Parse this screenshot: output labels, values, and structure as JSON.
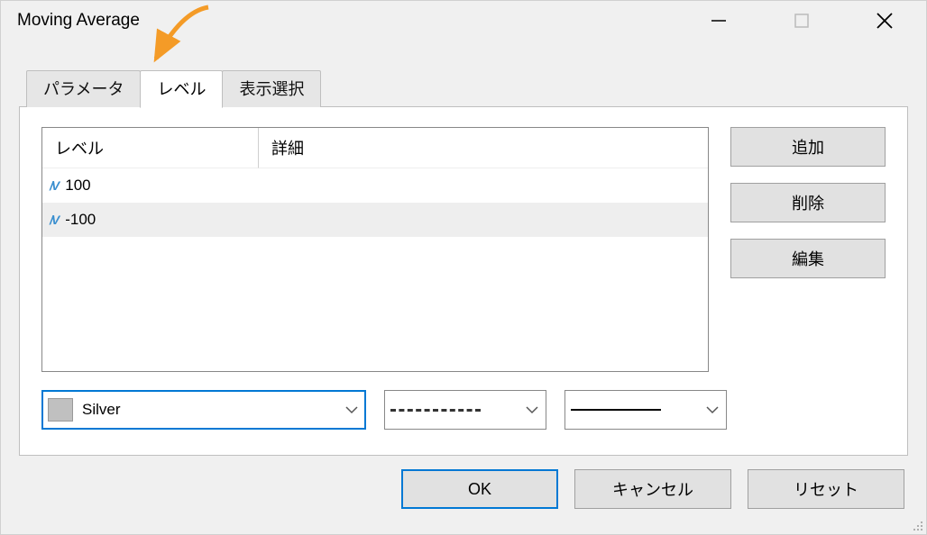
{
  "window": {
    "title": "Moving Average"
  },
  "tabs": [
    {
      "label": "パラメータ",
      "active": false
    },
    {
      "label": "レベル",
      "active": true
    },
    {
      "label": "表示選択",
      "active": false
    }
  ],
  "table": {
    "headers": {
      "level": "レベル",
      "detail": "詳細"
    },
    "rows": [
      {
        "level": "100",
        "detail": "",
        "selected": false
      },
      {
        "level": "-100",
        "detail": "",
        "selected": true
      }
    ]
  },
  "side_buttons": {
    "add": "追加",
    "delete": "削除",
    "edit": "編集"
  },
  "style": {
    "color_name": "Silver",
    "color_hex": "#C0C0C0",
    "line_style": "dashed",
    "line_width": "1"
  },
  "footer": {
    "ok": "OK",
    "cancel": "キャンセル",
    "reset": "リセット"
  }
}
